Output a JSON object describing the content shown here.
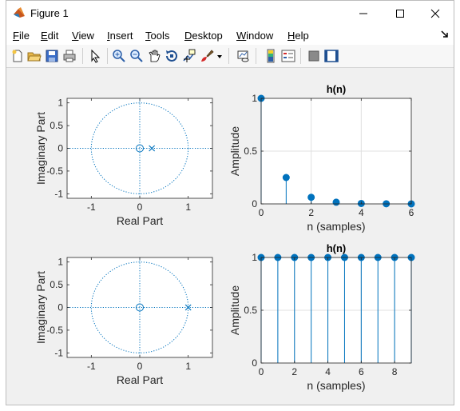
{
  "window": {
    "title": "Figure 1",
    "minimize": "—",
    "maximize": "☐",
    "close": "✕"
  },
  "menu": {
    "items": [
      {
        "label": "File",
        "key": "F",
        "rest": "ile"
      },
      {
        "label": "Edit",
        "key": "E",
        "rest": "dit"
      },
      {
        "label": "View",
        "key": "V",
        "rest": "iew"
      },
      {
        "label": "Insert",
        "key": "I",
        "rest": "nsert"
      },
      {
        "label": "Tools",
        "key": "T",
        "rest": "ools"
      },
      {
        "label": "Desktop",
        "key": "D",
        "rest": "esktop"
      },
      {
        "label": "Window",
        "key": "W",
        "rest": "indow"
      },
      {
        "label": "Help",
        "key": "H",
        "rest": "elp"
      }
    ],
    "dock_icon": "dock-arrow-icon"
  },
  "toolbar": {
    "icons": [
      "new-figure-icon",
      "open-file-icon",
      "save-icon",
      "print-icon",
      "pointer-icon",
      "zoom-in-icon",
      "zoom-out-icon",
      "pan-icon",
      "rotate-3d-icon",
      "data-cursor-icon",
      "brush-icon",
      "brush-dropdown-icon",
      "link-plot-icon",
      "colorbar-icon",
      "legend-icon",
      "hide-plot-tools-icon",
      "show-plot-tools-icon"
    ]
  },
  "chart_data": [
    {
      "type": "scatter",
      "title": "",
      "xlabel": "Real Part",
      "ylabel": "Imaginary Part",
      "xlim": [
        -1.5,
        1.5
      ],
      "ylim": [
        -1.1,
        1.1
      ],
      "xticks": [
        "-1",
        "0",
        "1"
      ],
      "yticks": [
        "-1",
        "-0.5",
        "0",
        "0.5",
        "1"
      ],
      "unit_circle": true,
      "zeros": [
        [
          0,
          0
        ]
      ],
      "poles": [
        [
          0.25,
          0
        ]
      ],
      "color": "#0072bd"
    },
    {
      "type": "stem",
      "title": "h(n)",
      "xlabel": "n (samples)",
      "ylabel": "Amplitude",
      "xlim": [
        0,
        6
      ],
      "ylim": [
        0,
        1
      ],
      "xticks": [
        "0",
        "2",
        "4",
        "6"
      ],
      "yticks": [
        "0",
        "0.5",
        "1"
      ],
      "x": [
        0,
        1,
        2,
        3,
        4,
        5,
        6
      ],
      "values": [
        1,
        0.25,
        0.0625,
        0.016,
        0.004,
        0.001,
        0.0002
      ],
      "grid": true,
      "color": "#0072bd"
    },
    {
      "type": "scatter",
      "title": "",
      "xlabel": "Real Part",
      "ylabel": "Imaginary Part",
      "xlim": [
        -1.5,
        1.5
      ],
      "ylim": [
        -1.1,
        1.1
      ],
      "xticks": [
        "-1",
        "0",
        "1"
      ],
      "yticks": [
        "-1",
        "-0.5",
        "0",
        "0.5",
        "1"
      ],
      "unit_circle": true,
      "zeros": [
        [
          0,
          0
        ]
      ],
      "poles": [
        [
          1,
          0
        ]
      ],
      "color": "#0072bd"
    },
    {
      "type": "stem",
      "title": "h(n)",
      "xlabel": "n (samples)",
      "ylabel": "Amplitude",
      "xlim": [
        0,
        9
      ],
      "ylim": [
        0,
        1
      ],
      "xticks": [
        "0",
        "2",
        "4",
        "6",
        "8"
      ],
      "yticks": [
        "0",
        "0.5",
        "1"
      ],
      "x": [
        0,
        1,
        2,
        3,
        4,
        5,
        6,
        7,
        8,
        9
      ],
      "values": [
        1,
        1,
        1,
        1,
        1,
        1,
        1,
        1,
        1,
        1
      ],
      "grid": true,
      "color": "#0072bd"
    }
  ]
}
